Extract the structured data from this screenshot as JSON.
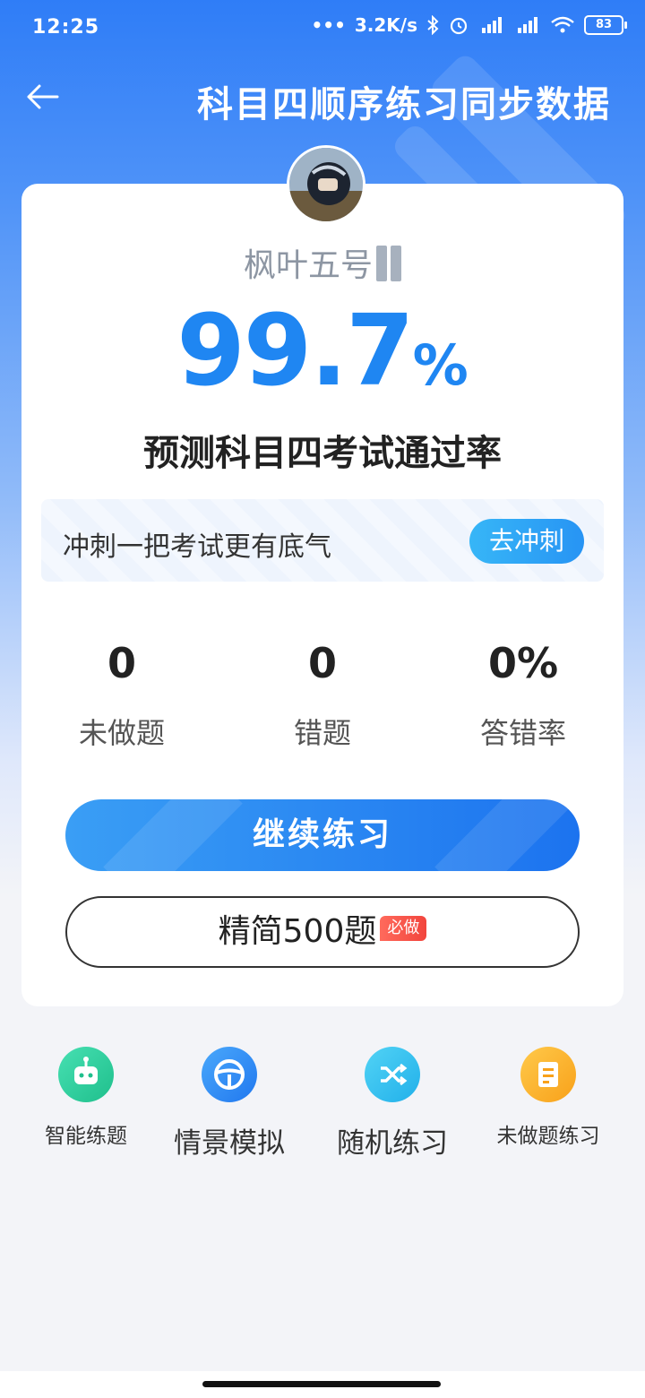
{
  "status_bar": {
    "time": "12:25",
    "network_speed": "3.2K/s",
    "battery": "83"
  },
  "header": {
    "title": "科目四顺序练习同步数据"
  },
  "profile": {
    "username": "枫叶五号"
  },
  "prediction": {
    "pass_rate_value": "99.7",
    "pass_rate_unit": "%",
    "label": "预测科目四考试通过率"
  },
  "sprint_banner": {
    "text": "冲刺一把考试更有底气",
    "button_label": "去冲刺"
  },
  "stats": [
    {
      "value": "0",
      "label": "未做题"
    },
    {
      "value": "0",
      "label": "错题"
    },
    {
      "value": "0%",
      "label": "答错率"
    }
  ],
  "buttons": {
    "continue_label": "继续练习",
    "jingjian_label": "精简500题",
    "must_tag": "必做"
  },
  "quick_actions": [
    {
      "label": "智能练题",
      "icon": "robot-icon",
      "color": "#2ecf9c"
    },
    {
      "label": "情景模拟",
      "icon": "steering-wheel-icon",
      "color": "#2d8ef5"
    },
    {
      "label": "随机练习",
      "icon": "shuffle-icon",
      "color": "#2ec0ef"
    },
    {
      "label": "未做题练习",
      "icon": "document-icon",
      "color": "#fbb126"
    }
  ],
  "colors": {
    "primary_blue": "#1f86f2",
    "header_blue": "#2f7df7"
  }
}
